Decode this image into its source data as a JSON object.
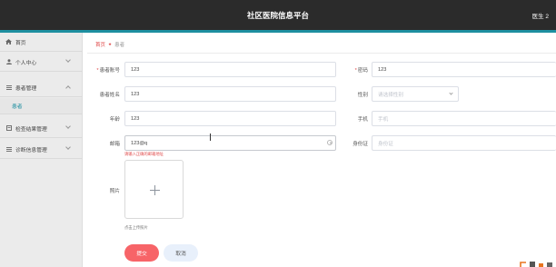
{
  "app": {
    "title": "社区医院信息平台",
    "user": "医生 2"
  },
  "sidebar": {
    "items": [
      {
        "label": "首页",
        "icon": "home-icon"
      },
      {
        "label": "个人中心",
        "icon": "user-icon"
      },
      {
        "label": "患者管理",
        "icon": "list-icon",
        "children": [
          {
            "label": "患者"
          }
        ]
      },
      {
        "label": "检查结果管理",
        "icon": "document-icon"
      },
      {
        "label": "诊断信息管理",
        "icon": "list-icon"
      }
    ]
  },
  "breadcrumb": {
    "home": "首页",
    "separator": "★",
    "current": "患者"
  },
  "form": {
    "account_label": "患者账号",
    "account_value": "123",
    "password_label": "密码",
    "password_value": "123",
    "name_label": "患者姓名",
    "name_value": "123",
    "gender_label": "性别",
    "gender_placeholder": "请选择性别",
    "age_label": "年龄",
    "age_value": "123",
    "phone_label": "手机",
    "phone_placeholder": "手机",
    "email_label": "邮箱",
    "email_value": "123@q",
    "idcard_label": "身份证",
    "idcard_placeholder": "身份证",
    "email_error": "请输入正确的邮箱地址",
    "photo_label": "照片",
    "photo_hint": "点击上传照片"
  },
  "buttons": {
    "submit": "提交",
    "cancel": "取消"
  },
  "colors": {
    "topbar": "#2b2b2b",
    "accent": "#1e8fa0",
    "submit": "#f76468",
    "cancel": "#e8f0fb",
    "error": "#e04a4a"
  }
}
